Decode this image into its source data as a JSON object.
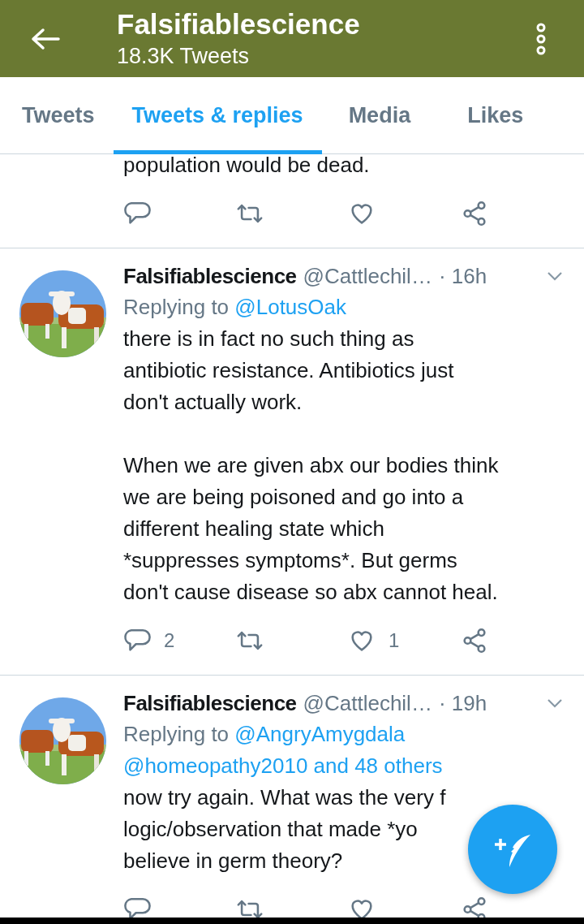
{
  "header": {
    "title": "Falsifiablescience",
    "subtitle": "18.3K Tweets"
  },
  "tabs": [
    {
      "label": "Tweets",
      "selected": false
    },
    {
      "label": "Tweets & replies",
      "selected": true
    },
    {
      "label": "Media",
      "selected": false
    },
    {
      "label": "Likes",
      "selected": false
    }
  ],
  "tweets": [
    {
      "kind": "partial",
      "lines": [
        "population would be dead."
      ]
    },
    {
      "kind": "full",
      "name": "Falsifiablescience",
      "handle": "@Cattlechil…",
      "time": "· 16h",
      "replying": {
        "label": "Replying to",
        "targets": [
          "@LotusOak"
        ]
      },
      "paragraphs": [
        [
          "there is in fact no such thing as",
          "antibiotic resistance. Antibiotics just",
          "don't actually work."
        ],
        [
          "When we are given abx our bodies think",
          "we are being poisoned and go into a",
          "different healing state which",
          "*suppresses symptoms*. But germs",
          "don't cause disease so abx cannot heal."
        ]
      ],
      "actions": {
        "replies": "2",
        "likes": "1"
      }
    },
    {
      "kind": "full",
      "name": "Falsifiablescience",
      "handle": "@Cattlechil…",
      "time": "· 19h",
      "replying": {
        "label": "Replying to",
        "targets": [
          "@AngryAmygdala",
          "@homeopathy2010 and 48 others"
        ]
      },
      "paragraphs": [
        [
          "now try again. What was the very f",
          "logic/observation that made *yo",
          "believe in germ theory?"
        ]
      ]
    }
  ]
}
